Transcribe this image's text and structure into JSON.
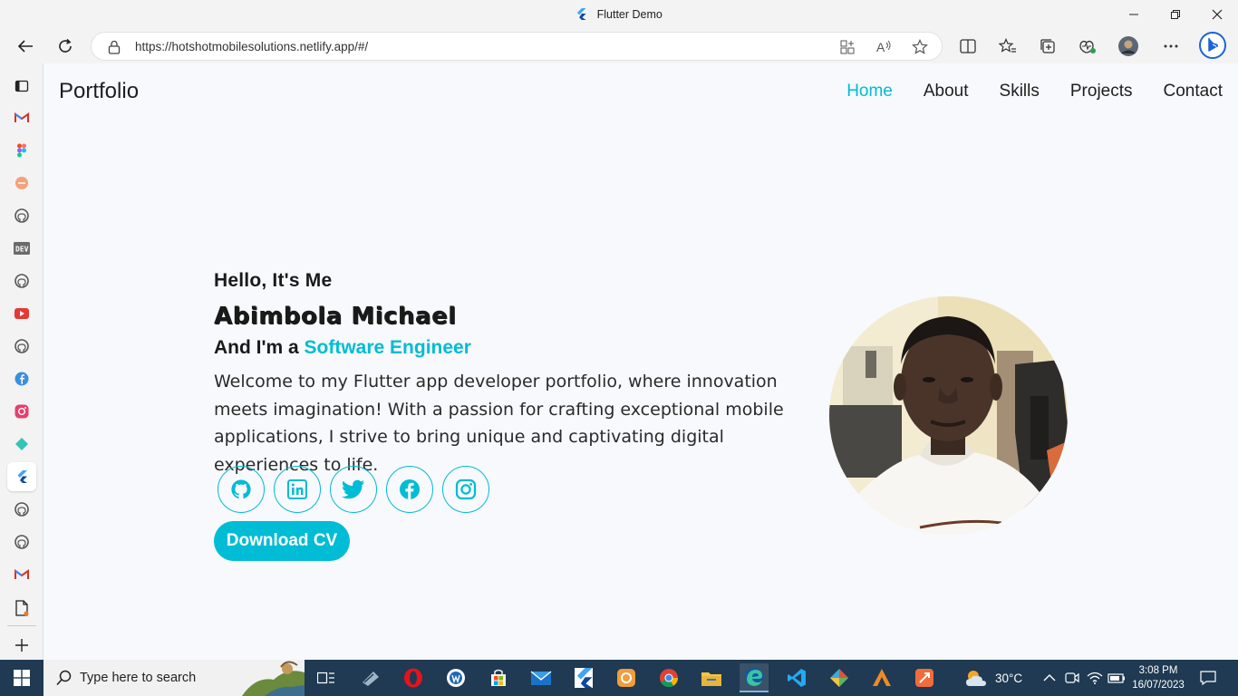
{
  "window": {
    "title": "Flutter Demo"
  },
  "browser": {
    "url": "https://hotshotmobilesolutions.netlify.app/#/"
  },
  "sidebar": {
    "items": [
      "tab-actions",
      "gmail",
      "figma",
      "app-orange",
      "github",
      "dev-to",
      "github",
      "youtube",
      "github",
      "facebook",
      "instagram",
      "app-teal",
      "flutter",
      "github",
      "github",
      "gmail",
      "file"
    ]
  },
  "site": {
    "brand": "Portfolio",
    "nav": [
      {
        "label": "Home",
        "active": true
      },
      {
        "label": "About",
        "active": false
      },
      {
        "label": "Skills",
        "active": false
      },
      {
        "label": "Projects",
        "active": false
      },
      {
        "label": "Contact",
        "active": false
      }
    ],
    "hero": {
      "greeting": "Hello, It's Me",
      "name": "Abimbola Michael",
      "role_prefix": "And I'm a",
      "role": "Software Engineer",
      "description": "Welcome to my Flutter app developer portfolio, where innovation meets imagination! With a passion for crafting exceptional mobile applications, I strive to bring unique and captivating digital experiences to life.",
      "socials": [
        "github-icon",
        "linkedin-icon",
        "twitter-icon",
        "facebook-icon",
        "instagram-icon"
      ],
      "cta": "Download CV"
    },
    "accent": "#00bcd4"
  },
  "taskbar": {
    "search_placeholder": "Type here to search",
    "weather": "30°C",
    "time": "3:08 PM",
    "date": "16/07/2023"
  }
}
